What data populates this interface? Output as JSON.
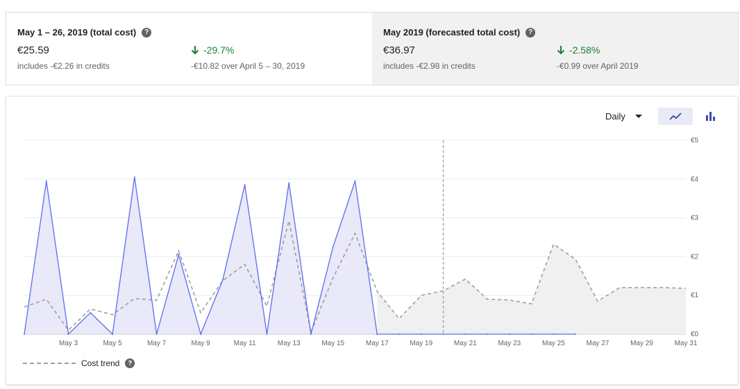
{
  "summary": {
    "current": {
      "title": "May 1 – 26, 2019 (total cost)",
      "value": "€25.59",
      "credits": "includes -€2.26 in credits",
      "change": "-29.7%",
      "change_detail": "-€10.82 over April 5 – 30, 2019"
    },
    "forecast": {
      "title": "May 2019 (forecasted total cost)",
      "value": "€36.97",
      "credits": "includes -€2.98 in credits",
      "change": "-2.58%",
      "change_detail": "-€0.99 over April 2019"
    },
    "help_glyph": "?"
  },
  "controls": {
    "granularity": "Daily",
    "line_icon": "line-chart-icon",
    "bar_icon": "bar-chart-icon"
  },
  "colors": {
    "actual": "#5c6bf0",
    "actual_fill": "#e3e4f8",
    "trend": "#9e9e9e",
    "forecast_fill": "#f0f0f0",
    "positive": "#188038"
  },
  "legend": {
    "trend_label": "Cost trend"
  },
  "chart_data": {
    "type": "line",
    "x_tick_labels": [
      "May 3",
      "May 5",
      "May 7",
      "May 9",
      "May 11",
      "May 13",
      "May 15",
      "May 17",
      "May 19",
      "May 21",
      "May 23",
      "May 25",
      "May 27",
      "May 29",
      "May 31"
    ],
    "y_tick_labels": [
      "€0",
      "€1",
      "€2",
      "€3",
      "€4",
      "€5"
    ],
    "ylim": [
      0,
      5
    ],
    "xlim": [
      1,
      31
    ],
    "today_marker_x": 20,
    "series": [
      {
        "x": [
          1,
          2,
          3,
          4,
          5,
          6,
          7,
          8,
          9,
          10,
          11,
          12,
          13,
          14,
          15,
          16,
          17,
          18,
          19,
          20,
          21,
          22,
          23,
          24,
          25,
          26
        ],
        "values": [
          0,
          3.95,
          0,
          0.55,
          0,
          4.05,
          0,
          2.05,
          0,
          1.4,
          3.85,
          0,
          3.9,
          0,
          2.25,
          3.95,
          0,
          0,
          0,
          0,
          0,
          0,
          0,
          0,
          0,
          0
        ]
      },
      {
        "name": "Cost trend",
        "x": [
          1,
          2,
          3,
          4,
          5,
          6,
          7,
          8,
          9,
          10,
          11,
          12,
          13,
          14,
          15,
          16,
          17,
          18,
          19,
          20,
          21,
          22,
          23,
          24,
          25,
          26,
          27,
          28,
          29,
          30,
          31
        ],
        "values": [
          0.7,
          0.9,
          0.1,
          0.65,
          0.5,
          0.92,
          0.87,
          2.15,
          0.55,
          1.38,
          1.8,
          0.72,
          2.92,
          0.05,
          1.45,
          2.6,
          1.1,
          0.4,
          1.0,
          1.12,
          1.42,
          0.9,
          0.88,
          0.78,
          2.32,
          1.93,
          0.85,
          1.2,
          1.2,
          1.2,
          1.18
        ]
      }
    ]
  }
}
